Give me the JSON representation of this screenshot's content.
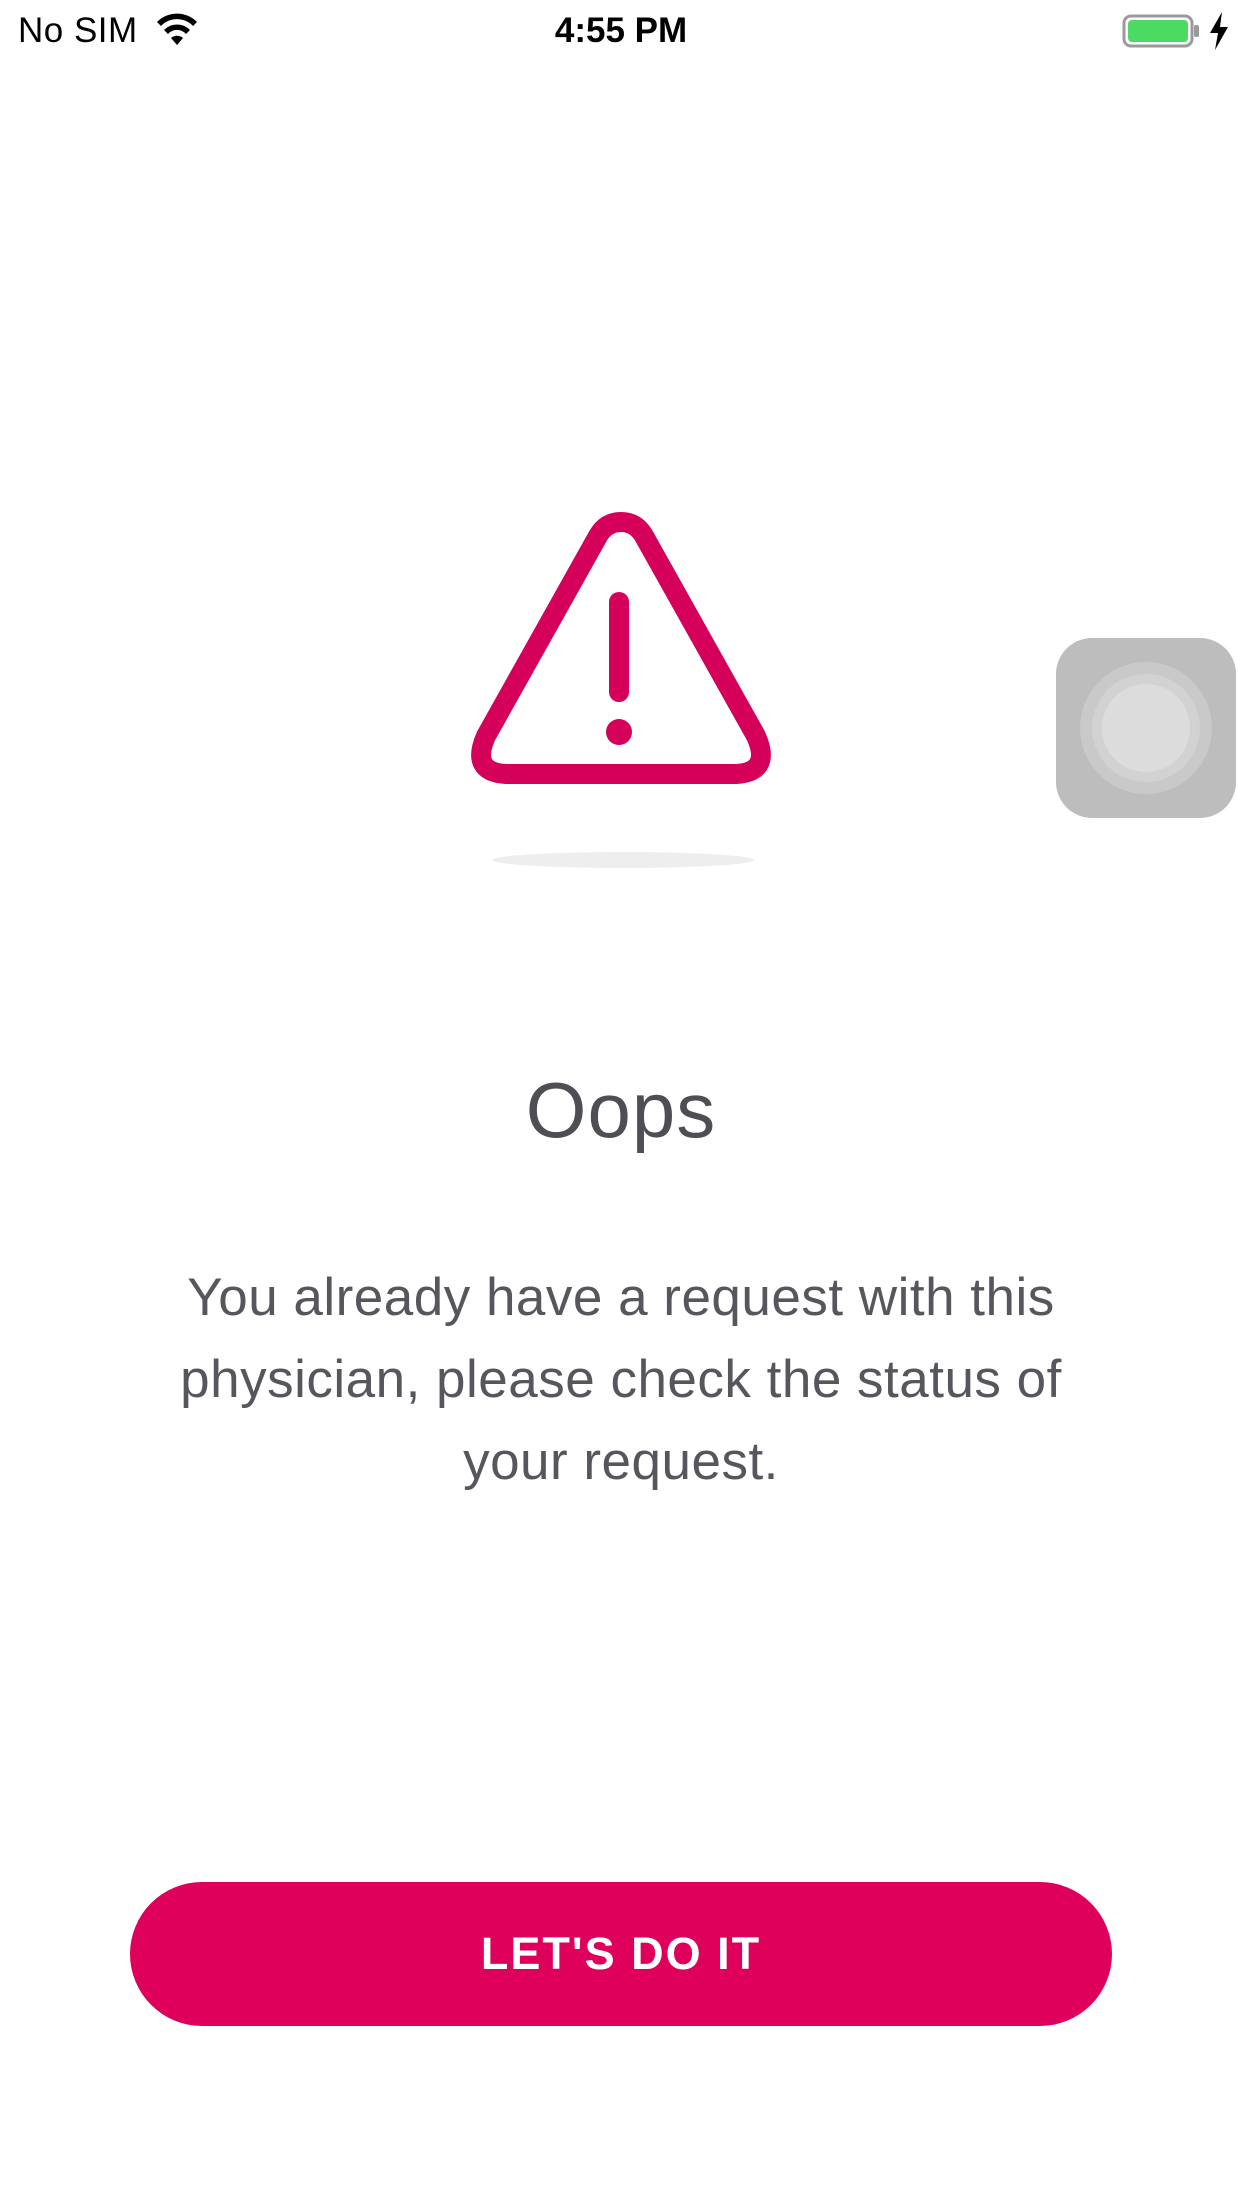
{
  "status_bar": {
    "carrier": "No SIM",
    "time": "4:55 PM",
    "battery_color": "#4cd964",
    "icons": [
      "wifi-icon",
      "battery-icon",
      "charging-bolt-icon"
    ]
  },
  "alert": {
    "icon": "warning-triangle-icon",
    "icon_color": "#d4005a",
    "title": "Oops",
    "message": "You already have a request with this physician, please check the status of your request."
  },
  "primary_button": {
    "label": "LET'S DO IT",
    "color": "#de005a"
  },
  "assistive_touch": {
    "icon": "assistive-touch-icon"
  }
}
